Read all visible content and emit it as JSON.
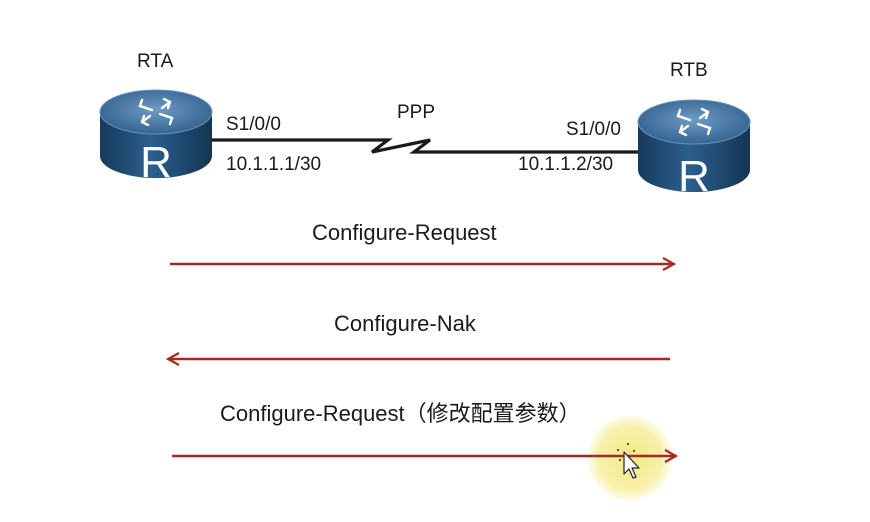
{
  "rta": {
    "name": "RTA",
    "interface": "S1/0/0",
    "ip": "10.1.1.1/30",
    "glyph": "R"
  },
  "rtb": {
    "name": "RTB",
    "interface": "S1/0/0",
    "ip": "10.1.1.2/30",
    "glyph": "R"
  },
  "link": {
    "protocol": "PPP"
  },
  "messages": [
    {
      "label": "Configure-Request",
      "direction": "RTA-to-RTB"
    },
    {
      "label": "Configure-Nak",
      "direction": "RTB-to-RTA"
    },
    {
      "label": "Configure-Request（修改配置参数）",
      "direction": "RTA-to-RTB"
    }
  ],
  "colors": {
    "arrow": "#a32a24",
    "router_top": "#3f6f9a",
    "router_body": "#1f4a73",
    "link": "#111111",
    "cursor_highlight": "#f5ea8a"
  },
  "icons": {
    "router": "router-icon",
    "cursor": "mouse-cursor-icon"
  }
}
